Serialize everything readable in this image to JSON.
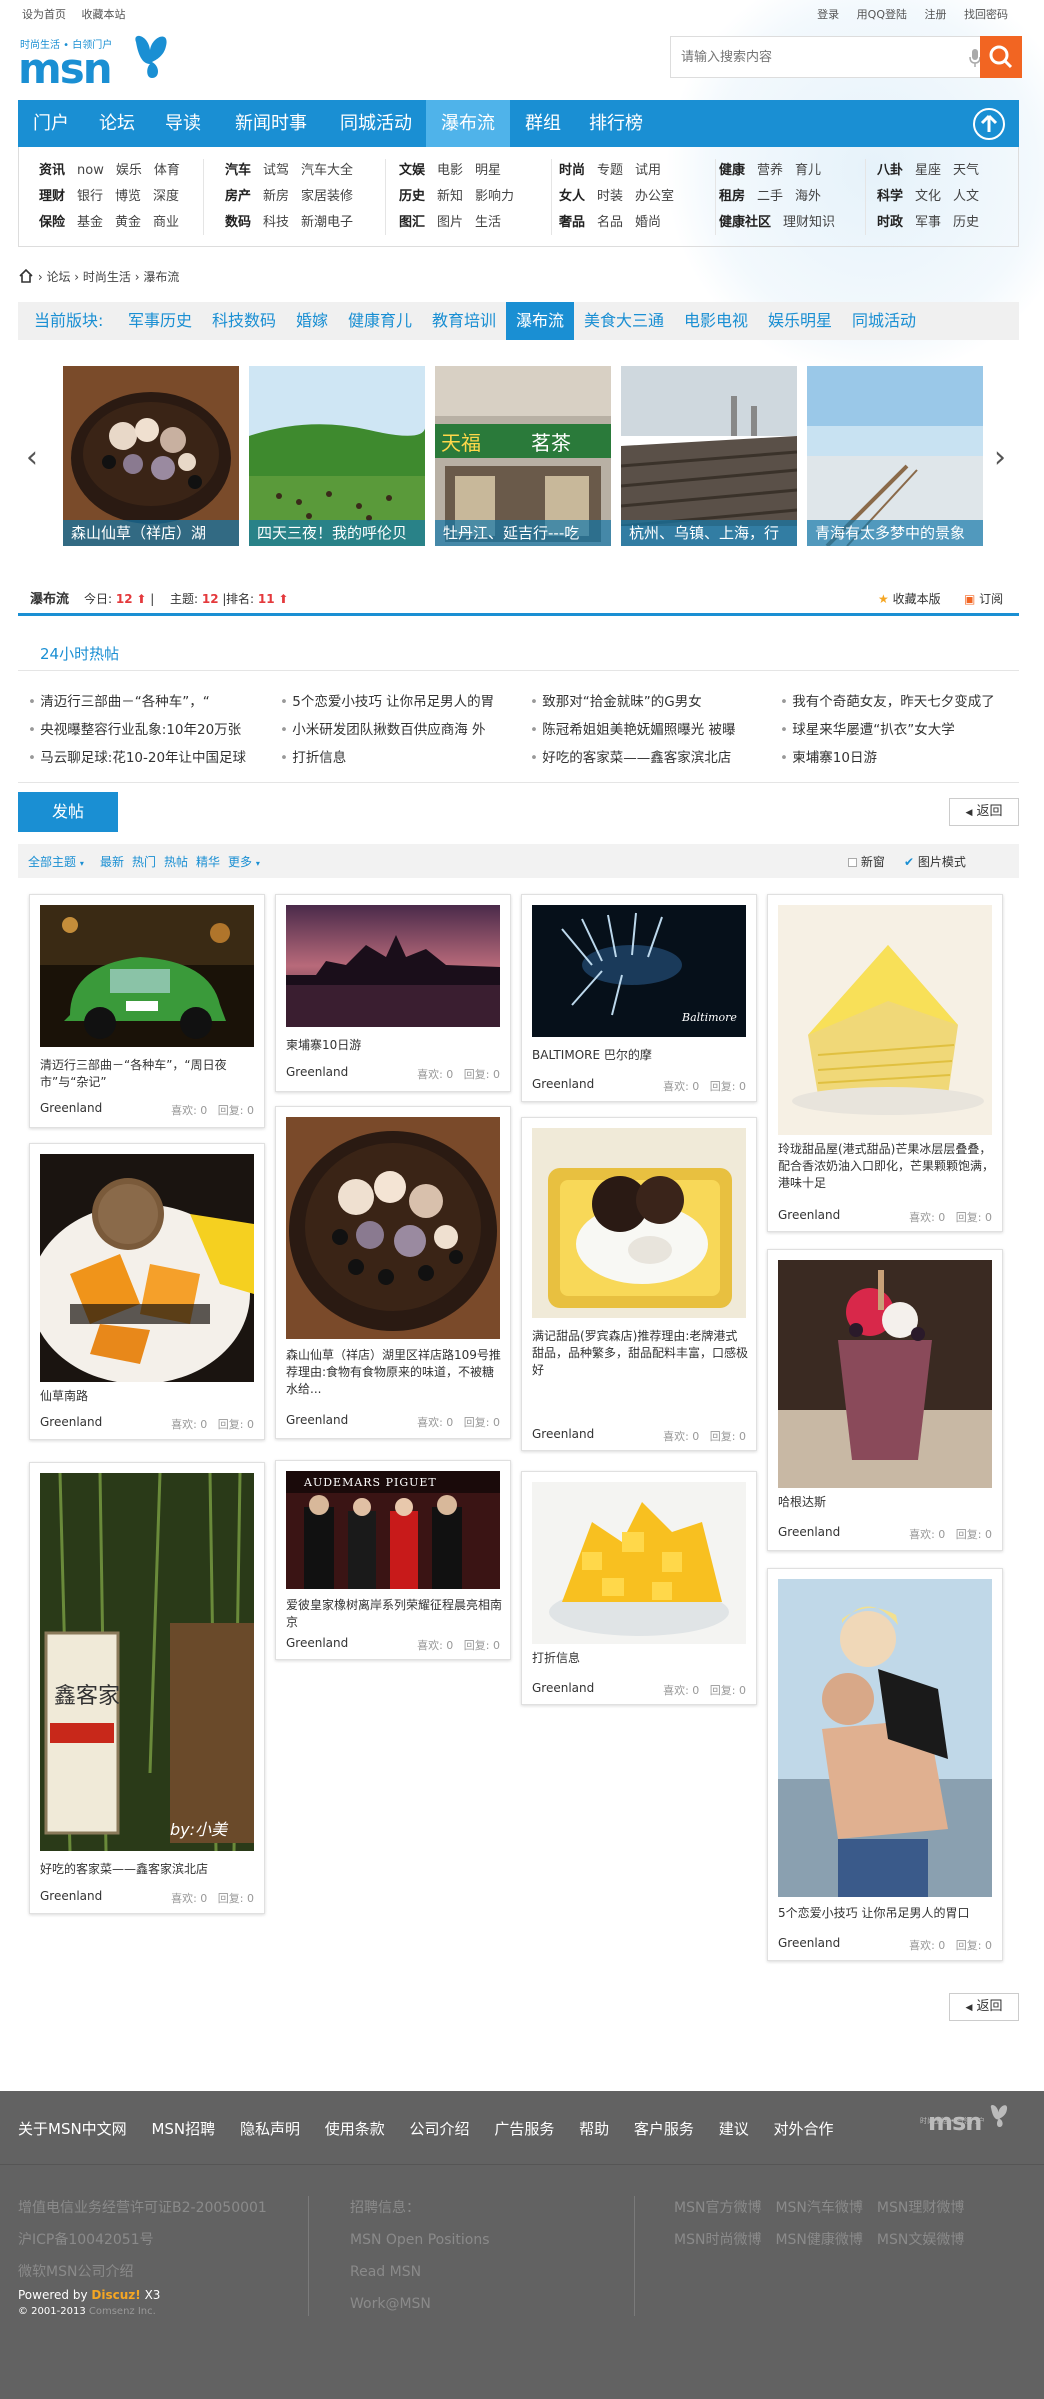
{
  "topbar": {
    "home": "设为首页",
    "fav": "收藏本站",
    "login": "登录",
    "qq_login": "用QQ登陆",
    "register": "注册",
    "find_pwd": "找回密码"
  },
  "logo": {
    "tagline": "时尚生活 • 白领门户",
    "text": "msn"
  },
  "search": {
    "placeholder": "请输入搜索内容"
  },
  "nav": {
    "items": [
      "门户",
      "论坛",
      "导读",
      "新闻时事",
      "同城活动",
      "瀑布流",
      "群组",
      "排行榜"
    ],
    "active": "瀑布流"
  },
  "subnav": [
    [
      [
        "资讯",
        "now",
        "娱乐",
        "体育"
      ],
      [
        "理财",
        "银行",
        "博览",
        "深度"
      ],
      [
        "保险",
        "基金",
        "黄金",
        "商业"
      ]
    ],
    [
      [
        "汽车",
        "试驾",
        "汽车大全"
      ],
      [
        "房产",
        "新房",
        "家居装修"
      ],
      [
        "数码",
        "科技",
        "新潮电子"
      ]
    ],
    [
      [
        "文娱",
        "电影",
        "明星"
      ],
      [
        "历史",
        "新知",
        "影响力"
      ],
      [
        "图汇",
        "图片",
        "生活"
      ]
    ],
    [
      [
        "时尚",
        "专题",
        "试用"
      ],
      [
        "女人",
        "时装",
        "办公室"
      ],
      [
        "奢品",
        "名品",
        "婚尚"
      ]
    ],
    [
      [
        "健康",
        "营养",
        "育儿"
      ],
      [
        "租房",
        "二手",
        "海外"
      ],
      [
        "健康社区",
        "理财知识"
      ]
    ],
    [
      [
        "八卦",
        "星座",
        "天气"
      ],
      [
        "科学",
        "文化",
        "人文"
      ],
      [
        "时政",
        "军事",
        "历史"
      ]
    ]
  ],
  "breadcrumb": {
    "items": [
      "论坛",
      "时尚生活",
      "瀑布流"
    ]
  },
  "sections": {
    "label": "当前版块:",
    "items": [
      "军事历史",
      "科技数码",
      "婚嫁",
      "健康育儿",
      "教育培训",
      "瀑布流",
      "美食大三通",
      "电影电视",
      "娱乐明星",
      "同城活动"
    ],
    "active": "瀑布流"
  },
  "carousel": [
    {
      "caption": "森山仙草（祥店）湖"
    },
    {
      "caption": "四天三夜！我的呼伦贝"
    },
    {
      "caption": "牡丹江、延吉行---吃"
    },
    {
      "caption": "杭州、乌镇、上海，行"
    },
    {
      "caption": "青海有太多梦中的景象"
    }
  ],
  "stats": {
    "title": "瀑布流",
    "today_label": "今日:",
    "today": "12",
    "topics_label": "主题:",
    "topics": "12",
    "rank_label": "排名:",
    "rank": "11",
    "fav": "收藏本版",
    "subscribe": "订阅"
  },
  "hot": {
    "title": "24小时热帖",
    "items": [
      [
        "清迈行三部曲－“各种车”，“",
        "央视曝整容行业乱象:10年20万张",
        "马云聊足球:花10-20年让中国足球"
      ],
      [
        "5个恋爱小技巧 让你吊足男人的胃",
        "小米研发团队揪数百供应商海 外",
        "打折信息"
      ],
      [
        "致那对“拾金就昧”的G男女",
        "陈冠希姐姐美艳妩媚照曝光 被曝",
        "好吃的客家菜——鑫客家滨北店"
      ],
      [
        "我有个奇葩女友，昨天七夕变成了",
        "球星来华屡遭“扒衣”女大学",
        "柬埔寨10日游"
      ]
    ]
  },
  "post_btn": "发帖",
  "back": "返回",
  "filter": {
    "all": "全部主题",
    "latest": "最新",
    "hot": "热门",
    "hotpost": "热帖",
    "digest": "精华",
    "more": "更多",
    "new_window": "新窗",
    "pic_mode": "图片模式"
  },
  "cards": [
    {
      "caption": "清迈行三部曲－“各种车”，“周日夜市”与“杂记”",
      "author": "Greenland",
      "likes": "喜欢: 0",
      "replies": "回复: 0"
    },
    {
      "caption": "仙草南路",
      "author": "Greenland",
      "likes": "喜欢: 0",
      "replies": "回复: 0"
    },
    {
      "caption": "好吃的客家菜——鑫客家滨北店",
      "author": "Greenland",
      "likes": "喜欢: 0",
      "replies": "回复: 0"
    },
    {
      "caption": "柬埔寨10日游",
      "author": "Greenland",
      "likes": "喜欢: 0",
      "replies": "回复: 0"
    },
    {
      "caption": "森山仙草（祥店）湖里区祥店路109号推荐理由:食物有食物原来的味道，不被糖水给...",
      "author": "Greenland",
      "likes": "喜欢: 0",
      "replies": "回复: 0"
    },
    {
      "caption": "爱彼皇家橡树离岸系列荣耀征程晨亮相南京",
      "author": "Greenland",
      "likes": "喜欢: 0",
      "replies": "回复: 0"
    },
    {
      "caption": "BALTIMORE 巴尔的摩",
      "author": "Greenland",
      "likes": "喜欢: 0",
      "replies": "回复: 0"
    },
    {
      "caption": "满记甜品(罗宾森店)推荐理由:老牌港式甜品，品种繁多，甜品配料丰富，口感极好",
      "author": "Greenland",
      "likes": "喜欢: 0",
      "replies": "回复: 0"
    },
    {
      "caption": "打折信息",
      "author": "Greenland",
      "likes": "喜欢: 0",
      "replies": "回复: 0"
    },
    {
      "caption": "玲珑甜品屋(港式甜品)芒果冰层层叠叠，配合香浓奶油入口即化，芒果颗颗饱满，港味十足",
      "author": "Greenland",
      "likes": "喜欢: 0",
      "replies": "回复: 0"
    },
    {
      "caption": "哈根达斯",
      "author": "Greenland",
      "likes": "喜欢: 0",
      "replies": "回复: 0"
    },
    {
      "caption": "5个恋爱小技巧 让你吊足男人的胃口",
      "author": "Greenland",
      "likes": "喜欢: 0",
      "replies": "回复: 0"
    }
  ],
  "image_labels": {
    "baltimore": "Baltimore",
    "by_xiaomei": "by:小美",
    "sign_left": "天福",
    "sign_right": "茗茶",
    "audemars": "AUDEMARS PIGUET",
    "restaurant": "鑫客家"
  },
  "footer": {
    "links": [
      "关于MSN中文网",
      "MSN招聘",
      "隐私声明",
      "使用条款",
      "公司介绍",
      "广告服务",
      "帮助",
      "客户服务",
      "建议",
      "对外合作"
    ],
    "col1": [
      "增值电信业务经营许可证B2-20050001",
      "沪ICP备10042051号",
      "微软MSN公司介绍"
    ],
    "powered": "Powered by",
    "discuz": "Discuz!",
    "discuz_ver": "X3",
    "copyright": "© 2001-2013",
    "comsenz": "Comsenz Inc.",
    "col2": [
      "招聘信息：",
      "MSN Open Positions",
      "Read MSN",
      "Work@MSN"
    ],
    "col3": [
      [
        "MSN官方微博",
        "MSN汽车微博",
        "MSN理财微博"
      ],
      [
        "MSN时尚微博",
        "MSN健康微博",
        "MSN文娱微博"
      ]
    ]
  },
  "colors": {
    "brand": "#1a8fd3",
    "accent": "#f26522",
    "footer": "#626262"
  }
}
